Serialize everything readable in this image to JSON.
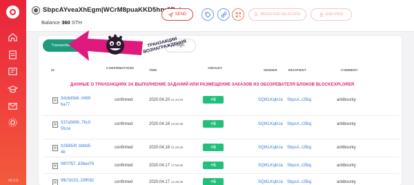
{
  "sidebar": {
    "version": "V0.2.0",
    "items": [
      {
        "icon": "home-icon"
      },
      {
        "icon": "document-icon"
      },
      {
        "icon": "book-icon"
      },
      {
        "icon": "graduation-cap-icon"
      },
      {
        "icon": "mail-icon"
      },
      {
        "icon": "settings-icon"
      }
    ]
  },
  "header": {
    "address": "SbpcAYveaXhEgm|WCrM8puaKKD5hnr2Baj",
    "balance_label": "Balance",
    "balance_value": "360",
    "balance_unit": "STH",
    "send_label": "SEND",
    "register_delegate_label": "REGISTER DELEGATE",
    "end_pwd_label": "END PWD"
  },
  "tabs": {
    "transactions": "Transactions 72",
    "sign": "Sign"
  },
  "annotation": {
    "callout": "ТРАНЗАКЦИИ ВОЗНАГРАЖДЕНИЯ",
    "banner": "ДАННЫЕ О ТРАНЗАКЦИЯХ ЗА ВЫПОЛНЕНИЕ ЗАДАНИЙ ИЛИ РАЗМЕЩЕНИЕ ЗАКАЗОВ ИЗ ОБОЗРЕВАТЕЛЯ БЛОКОВ BLOCKEXPLORER"
  },
  "table": {
    "columns": {
      "id": "ID",
      "confirmations": "CONFIRMATIONS",
      "time": "TIME",
      "amount": "AMOUNT",
      "sender": "SENDER",
      "recipient": "RECIPIENT",
      "comment": "COMMENT"
    },
    "rows": [
      {
        "id": "3dc6d5b6..04996a77",
        "status": "confirmed",
        "date": "2020.04.20",
        "time": "01:44:25",
        "amount": "+5",
        "sender": "SQtKLKqkUa",
        "recipient": "SbpcA..r2Baj",
        "comment": "antibounty"
      },
      {
        "id": "537a5898..76c05fcce",
        "status": "confirmed",
        "date": "2020.04.18",
        "time": "18:40:35",
        "amount": "+5",
        "sender": "SQtKLKqkUa",
        "recipient": "SbpcA..r2Baj",
        "comment": "antibounty"
      },
      {
        "id": "fc08854f..bb9d54b",
        "status": "confirmed",
        "date": "2020.04.18",
        "time": "01:26:35",
        "amount": "+5",
        "sender": "SQtKLKqkUa",
        "recipient": "SbpcA..r2Baj",
        "comment": "antibounty"
      },
      {
        "id": "f4f07f57..836ed76",
        "status": "confirmed",
        "date": "2020.04.17",
        "time": "17:56:08",
        "amount": "+5",
        "sender": "SQtKLKqkUa",
        "recipient": "SbpcA..r2Baj",
        "comment": "antibounty"
      },
      {
        "id": "9fb7d153..20ff092",
        "status": "confirmed",
        "date": "2020.04.17",
        "time": "14:48:35",
        "amount": "+5",
        "sender": "SQtKLKqkUa",
        "recipient": "SbpcA..r2Baj",
        "comment": "antibounty"
      }
    ]
  },
  "colors": {
    "sidebar_top": "#e8243a",
    "accent_red": "#e33a3a",
    "tab_green": "#1d9c7c",
    "amount_green": "#22c07a",
    "link_blue": "#3a7bd5",
    "annotation_magenta": "#e0197d"
  }
}
